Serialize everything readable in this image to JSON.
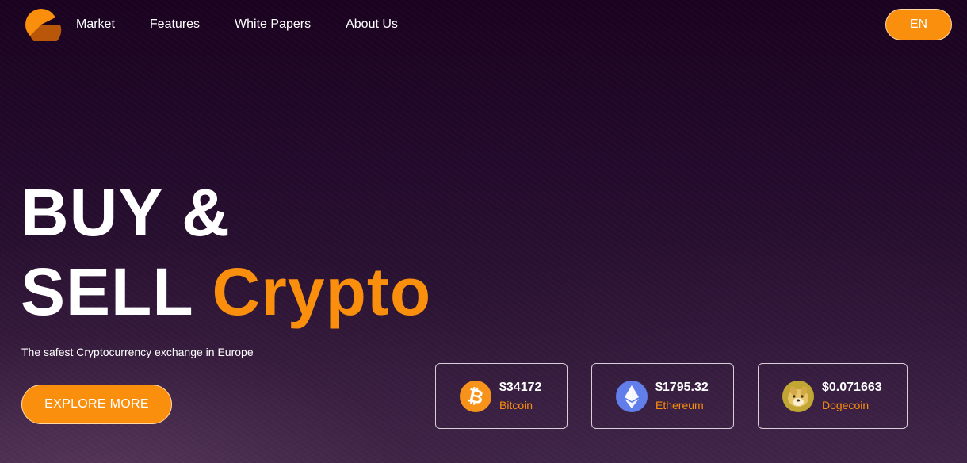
{
  "nav": {
    "links": [
      {
        "label": "Market"
      },
      {
        "label": "Features"
      },
      {
        "label": "White Papers"
      },
      {
        "label": "About Us"
      }
    ],
    "lang_label": "EN"
  },
  "hero": {
    "title_line1": "BUY &",
    "title_line2_white": "SELL",
    "title_line2_accent": "Crypto",
    "subtitle": "The safest Cryptocurrency exchange in Europe",
    "cta_label": "EXPLORE MORE"
  },
  "coins": [
    {
      "price": "$34172",
      "name": "Bitcoin",
      "icon": "bitcoin-icon"
    },
    {
      "price": "$1795.32",
      "name": "Ethereum",
      "icon": "ethereum-icon"
    },
    {
      "price": "$0.071663",
      "name": "Dogecoin",
      "icon": "dogecoin-icon"
    }
  ],
  "colors": {
    "accent": "#fa8f0e",
    "background_top": "#1a0220",
    "background_bottom": "#3a2442",
    "ethereum": "#627eea"
  }
}
